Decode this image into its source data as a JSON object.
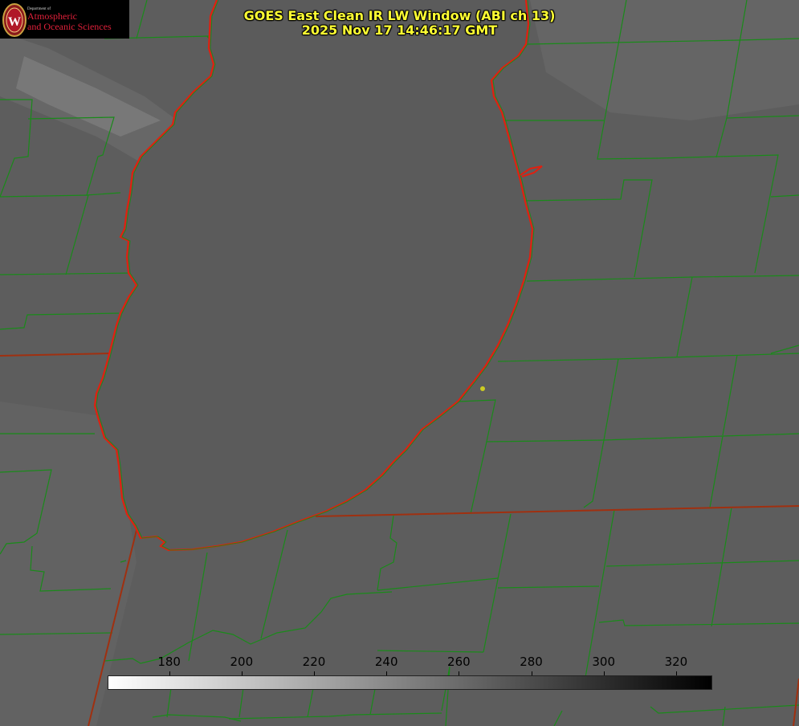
{
  "header": {
    "title_line1": "GOES East Clean IR LW Window (ABI ch 13)",
    "title_line2": "2025 Nov 17 14:46:17 GMT"
  },
  "logo": {
    "department": "Department of",
    "line1": "Atmospheric",
    "line2": "and Oceanic Sciences",
    "seal_letter": "W"
  },
  "colorbar": {
    "min_value": 163,
    "max_value": 330,
    "ticks": [
      "180",
      "200",
      "220",
      "240",
      "260",
      "280",
      "300",
      "320"
    ],
    "start_color": "#ffffff",
    "end_color": "#000000"
  },
  "colors": {
    "county_lines": "#1a8a1a",
    "state_lines": "#e02010",
    "marker": "#cccc22",
    "title": "#ffff33"
  },
  "layers": {
    "county_boundaries": "visible",
    "state_boundaries": "visible",
    "location_marker": "visible"
  }
}
